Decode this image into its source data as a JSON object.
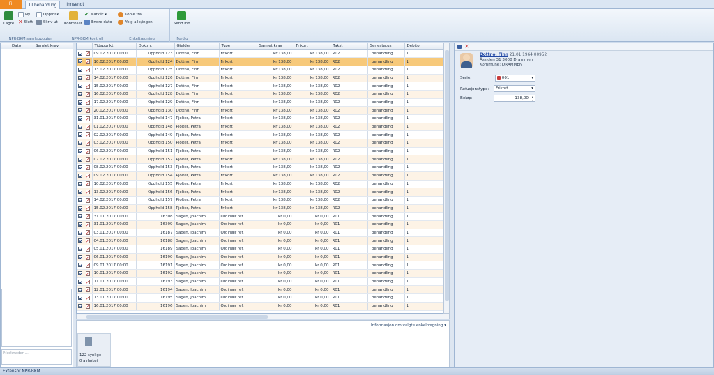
{
  "tabs": {
    "file": "Fil",
    "main": "Til behandling",
    "sent": "Innsendt"
  },
  "ribbon": {
    "save": "Lagre",
    "new": "Ny",
    "refresh": "Oppfrisk",
    "delete": "Slett",
    "print": "Skriv ut",
    "group1": "NPR-BKM samleoppgjør",
    "control": "Kontroller",
    "mark": "Markér",
    "change_date": "Endre dato",
    "group2": "NPR-BKM kontroll",
    "connect": "Koble fra",
    "choose_all": "Velg alle/ingen",
    "group3": "Enkeltregning",
    "send": "Send inn",
    "group4": "Ferdig"
  },
  "left_panel": {
    "col_date": "Dato",
    "col_total": "Samlet krav",
    "search_placeholder": "Merknader ..."
  },
  "grid": {
    "columns": [
      "Tidspunkt",
      "Dok.nr.",
      "Gjelder",
      "Type",
      "Samlet krav",
      "Frikort",
      "Takst",
      "Seriestatus",
      "Debitor"
    ],
    "rows": [
      [
        "09.02.2017 00:00",
        "Opphold 123",
        "Dottno, Finn",
        "Frikort",
        "kr 138,00",
        "kr 138,00",
        "R02",
        "I behandling",
        "1"
      ],
      [
        "10.02.2017 00:00",
        "Opphold 124",
        "Dottno, Finn",
        "Frikort",
        "kr 138,00",
        "kr 138,00",
        "R02",
        "I behandling",
        "1"
      ],
      [
        "13.02.2017 00:00",
        "Opphold 125",
        "Dottno, Finn",
        "Frikort",
        "kr 138,00",
        "kr 138,00",
        "R02",
        "I behandling",
        "1"
      ],
      [
        "14.02.2017 00:00",
        "Opphold 126",
        "Dottno, Finn",
        "Frikort",
        "kr 138,00",
        "kr 138,00",
        "R02",
        "I behandling",
        "1"
      ],
      [
        "15.02.2017 00:00",
        "Opphold 127",
        "Dottno, Finn",
        "Frikort",
        "kr 138,00",
        "kr 138,00",
        "R02",
        "I behandling",
        "1"
      ],
      [
        "16.02.2017 00:00",
        "Opphold 128",
        "Dottno, Finn",
        "Frikort",
        "kr 138,00",
        "kr 138,00",
        "R02",
        "I behandling",
        "1"
      ],
      [
        "17.02.2017 00:00",
        "Opphold 129",
        "Dottno, Finn",
        "Frikort",
        "kr 138,00",
        "kr 138,00",
        "R02",
        "I behandling",
        "1"
      ],
      [
        "20.02.2017 00:00",
        "Opphold 130",
        "Dottno, Finn",
        "Frikort",
        "kr 138,00",
        "kr 138,00",
        "R02",
        "I behandling",
        "1"
      ],
      [
        "31.01.2017 00:00",
        "Opphold 147",
        "Pjolter, Petra",
        "Frikort",
        "kr 138,00",
        "kr 138,00",
        "R02",
        "I behandling",
        "1"
      ],
      [
        "01.02.2017 00:00",
        "Opphold 148",
        "Pjolter, Petra",
        "Frikort",
        "kr 138,00",
        "kr 138,00",
        "R02",
        "I behandling",
        "1"
      ],
      [
        "02.02.2017 00:00",
        "Opphold 149",
        "Pjolter, Petra",
        "Frikort",
        "kr 138,00",
        "kr 138,00",
        "R02",
        "I behandling",
        "1"
      ],
      [
        "03.02.2017 00:00",
        "Opphold 150",
        "Pjolter, Petra",
        "Frikort",
        "kr 138,00",
        "kr 138,00",
        "R02",
        "I behandling",
        "1"
      ],
      [
        "06.02.2017 00:00",
        "Opphold 151",
        "Pjolter, Petra",
        "Frikort",
        "kr 138,00",
        "kr 138,00",
        "R02",
        "I behandling",
        "1"
      ],
      [
        "07.02.2017 00:00",
        "Opphold 152",
        "Pjolter, Petra",
        "Frikort",
        "kr 138,00",
        "kr 138,00",
        "R02",
        "I behandling",
        "1"
      ],
      [
        "08.02.2017 00:00",
        "Opphold 153",
        "Pjolter, Petra",
        "Frikort",
        "kr 138,00",
        "kr 138,00",
        "R02",
        "I behandling",
        "1"
      ],
      [
        "09.02.2017 00:00",
        "Opphold 154",
        "Pjolter, Petra",
        "Frikort",
        "kr 138,00",
        "kr 138,00",
        "R02",
        "I behandling",
        "1"
      ],
      [
        "10.02.2017 00:00",
        "Opphold 155",
        "Pjolter, Petra",
        "Frikort",
        "kr 138,00",
        "kr 138,00",
        "R02",
        "I behandling",
        "1"
      ],
      [
        "13.02.2017 00:00",
        "Opphold 156",
        "Pjolter, Petra",
        "Frikort",
        "kr 138,00",
        "kr 138,00",
        "R02",
        "I behandling",
        "1"
      ],
      [
        "14.02.2017 00:00",
        "Opphold 157",
        "Pjolter, Petra",
        "Frikort",
        "kr 138,00",
        "kr 138,00",
        "R02",
        "I behandling",
        "1"
      ],
      [
        "15.02.2017 00:00",
        "Opphold 158",
        "Pjolter, Petra",
        "Frikort",
        "kr 138,00",
        "kr 138,00",
        "R02",
        "I behandling",
        "1"
      ],
      [
        "31.01.2017 00:00",
        "16308",
        "Sagen, Joachim",
        "Ordinær ref.",
        "kr 0,00",
        "kr 0,00",
        "R01",
        "I behandling",
        "1"
      ],
      [
        "31.01.2017 00:00",
        "16309",
        "Sagen, Joachim",
        "Ordinær ref.",
        "kr 0,00",
        "kr 0,00",
        "R01",
        "I behandling",
        "1"
      ],
      [
        "03.01.2017 00:00",
        "16187",
        "Sagen, Joachim",
        "Ordinær ref.",
        "kr 0,00",
        "kr 0,00",
        "R01",
        "I behandling",
        "1"
      ],
      [
        "04.01.2017 00:00",
        "16188",
        "Sagen, Joachim",
        "Ordinær ref.",
        "kr 0,00",
        "kr 0,00",
        "R01",
        "I behandling",
        "1"
      ],
      [
        "05.01.2017 00:00",
        "16189",
        "Sagen, Joachim",
        "Ordinær ref.",
        "kr 0,00",
        "kr 0,00",
        "R01",
        "I behandling",
        "1"
      ],
      [
        "06.01.2017 00:00",
        "16190",
        "Sagen, Joachim",
        "Ordinær ref.",
        "kr 0,00",
        "kr 0,00",
        "R01",
        "I behandling",
        "1"
      ],
      [
        "09.01.2017 00:00",
        "16191",
        "Sagen, Joachim",
        "Ordinær ref.",
        "kr 0,00",
        "kr 0,00",
        "R01",
        "I behandling",
        "1"
      ],
      [
        "10.01.2017 00:00",
        "16192",
        "Sagen, Joachim",
        "Ordinær ref.",
        "kr 0,00",
        "kr 0,00",
        "R01",
        "I behandling",
        "1"
      ],
      [
        "11.01.2017 00:00",
        "16193",
        "Sagen, Joachim",
        "Ordinær ref.",
        "kr 0,00",
        "kr 0,00",
        "R01",
        "I behandling",
        "1"
      ],
      [
        "12.01.2017 00:00",
        "16194",
        "Sagen, Joachim",
        "Ordinær ref.",
        "kr 0,00",
        "kr 0,00",
        "R01",
        "I behandling",
        "1"
      ],
      [
        "13.01.2017 00:00",
        "16195",
        "Sagen, Joachim",
        "Ordinær ref.",
        "kr 0,00",
        "kr 0,00",
        "R01",
        "I behandling",
        "1"
      ],
      [
        "16.01.2017 00:00",
        "16196",
        "Sagen, Joachim",
        "Ordinær ref.",
        "kr 0,00",
        "kr 0,00",
        "R01",
        "I behandling",
        "1"
      ]
    ],
    "selected_row": 1
  },
  "info": {
    "label": "Informasjon om valgte enkeltregning",
    "visible_count": "122 synlige",
    "rejected_count": "0 avhøket"
  },
  "patient": {
    "name": "Dottno, Finn",
    "birth": "21.01.1964 00952",
    "address": "Åssiden 31 3008 Drammen",
    "municipality": "Kommune: DRAMMEN",
    "series_label": "Serie:",
    "series_value": "001",
    "refund_label": "Refusjonstype:",
    "refund_value": "Frikort",
    "amount_label": "Beløp:",
    "amount_value": "138,00"
  },
  "status_bar": "Extensor NPR-BKM",
  "colors": {
    "accent": "#f08a22",
    "selected": "#f7c97a",
    "alt_row": "#fdf3e6",
    "ribbon": "#dbe6f2"
  }
}
